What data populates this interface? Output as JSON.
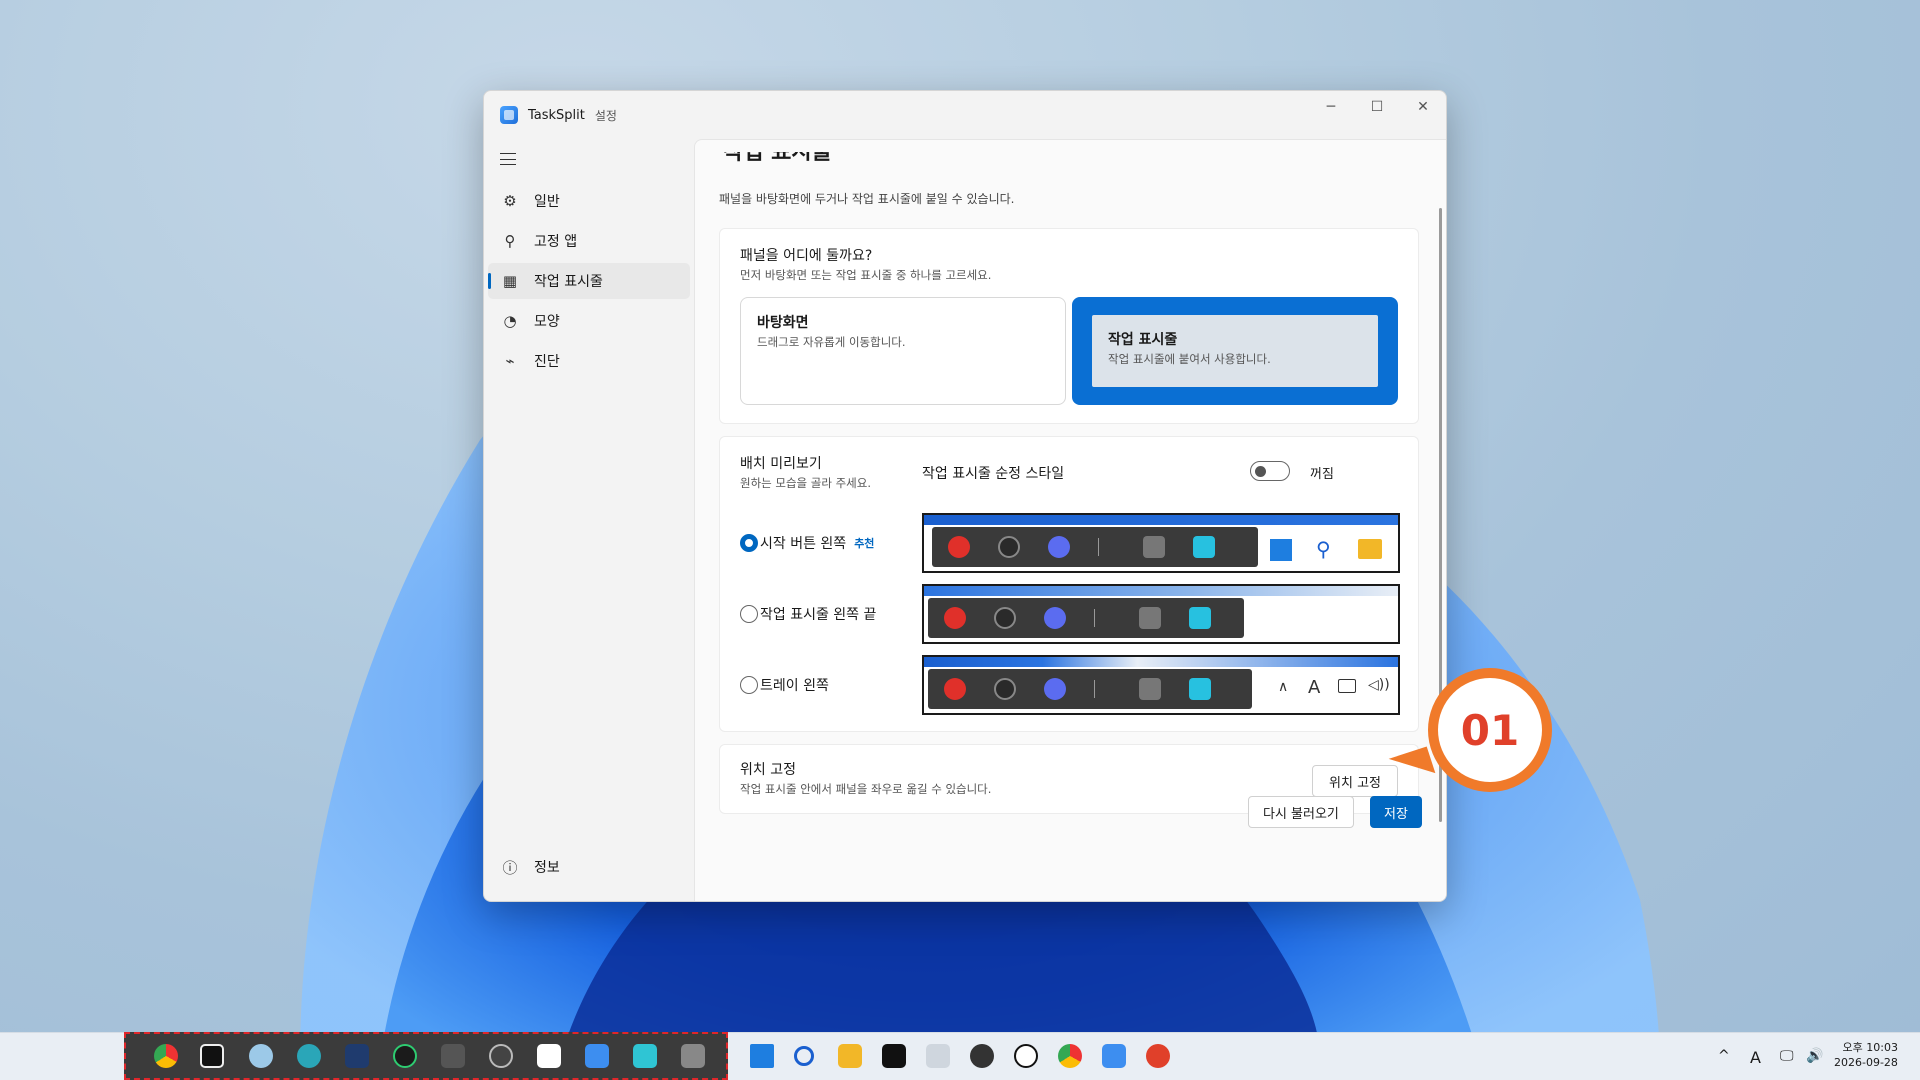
{
  "window": {
    "app_name": "TaskSplit",
    "app_sub": "설정",
    "controls": {
      "minimize": "─",
      "maximize": "☐",
      "close": "✕"
    }
  },
  "sidebar": {
    "items": [
      {
        "label": "일반",
        "icon": "gear-icon",
        "glyph": "⚙"
      },
      {
        "label": "고정 앱",
        "icon": "pin-icon",
        "glyph": "⚲"
      },
      {
        "label": "작업 표시줄",
        "icon": "grid-icon",
        "glyph": "▦"
      },
      {
        "label": "모양",
        "icon": "palette-icon",
        "glyph": "◔"
      },
      {
        "label": "진단",
        "icon": "pulse-icon",
        "glyph": "⌁"
      }
    ],
    "active_index": 2,
    "bottom": {
      "label": "정보",
      "icon": "info-icon",
      "glyph": "ⓘ"
    }
  },
  "content": {
    "page_title": "작업 표시줄",
    "page_desc": "패널을 바탕화면에 두거나 작업 표시줄에 붙일 수 있습니다.",
    "placement_card": {
      "title": "패널을 어디에 둘까요?",
      "desc": "먼저 바탕화면 또는 작업 표시줄 중 하나를 고르세요.",
      "options": [
        {
          "title": "바탕화면",
          "desc": "드래그로 자유롭게 이동합니다.",
          "selected": false
        },
        {
          "title": "작업 표시줄",
          "desc": "작업 표시줄에 붙여서 사용합니다.",
          "selected": true
        }
      ]
    },
    "preview_card": {
      "title": "배치 미리보기",
      "desc": "원하는 모습을 골라 주세요.",
      "style_label": "작업 표시줄 순정 스타일",
      "toggle_state": "꺼짐",
      "toggle_on": false,
      "options": [
        {
          "label": "시작 버튼 왼쪽",
          "badge": "추천",
          "checked": true
        },
        {
          "label": "작업 표시줄 왼쪽 끝",
          "badge": "",
          "checked": false
        },
        {
          "label": "트레이 왼쪽",
          "badge": "",
          "checked": false
        }
      ]
    },
    "pin_card": {
      "title": "위치 고정",
      "desc": "작업 표시줄 안에서 패널을 좌우로 옮길 수 있습니다.",
      "button": "위치 고정"
    },
    "footer": {
      "reload": "다시 불러오기",
      "save": "저장"
    }
  },
  "callout": {
    "text": "01"
  },
  "taskbar": {
    "tray": {
      "chevron": "^",
      "ime": "A",
      "network": "🖵",
      "volume": "🔊"
    },
    "clock": {
      "time": "오후 10:03",
      "date": "2026-09-28"
    }
  },
  "colors": {
    "accent": "#0067c0",
    "callout": "#f07a2a",
    "panel": "#3a3a3a",
    "dashed_border": "#e0262a"
  }
}
